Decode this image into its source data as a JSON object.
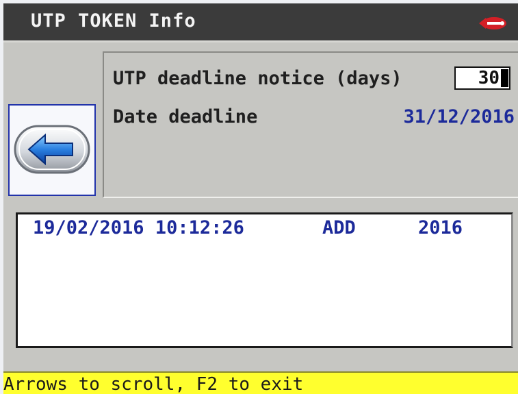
{
  "window": {
    "title": "UTP TOKEN Info",
    "brand_icon": "silca-logo-icon"
  },
  "info": {
    "notice_label": "UTP deadline notice (days)",
    "notice_value": "30",
    "date_label": "Date deadline",
    "date_value": "31/12/2016"
  },
  "navigation": {
    "back_icon": "arrow-left-icon"
  },
  "log": {
    "rows": [
      {
        "datetime": "19/02/2016 10:12:26",
        "action": "ADD",
        "year": "2016"
      }
    ]
  },
  "status": {
    "text": "Arrows to scroll, F2 to exit"
  },
  "colors": {
    "titlebar": "#3b3b3b",
    "panel": "#c6c6c2",
    "value_text": "#1c2a9a",
    "statusbar": "#ffff2e",
    "logo_red": "#d31f26"
  }
}
